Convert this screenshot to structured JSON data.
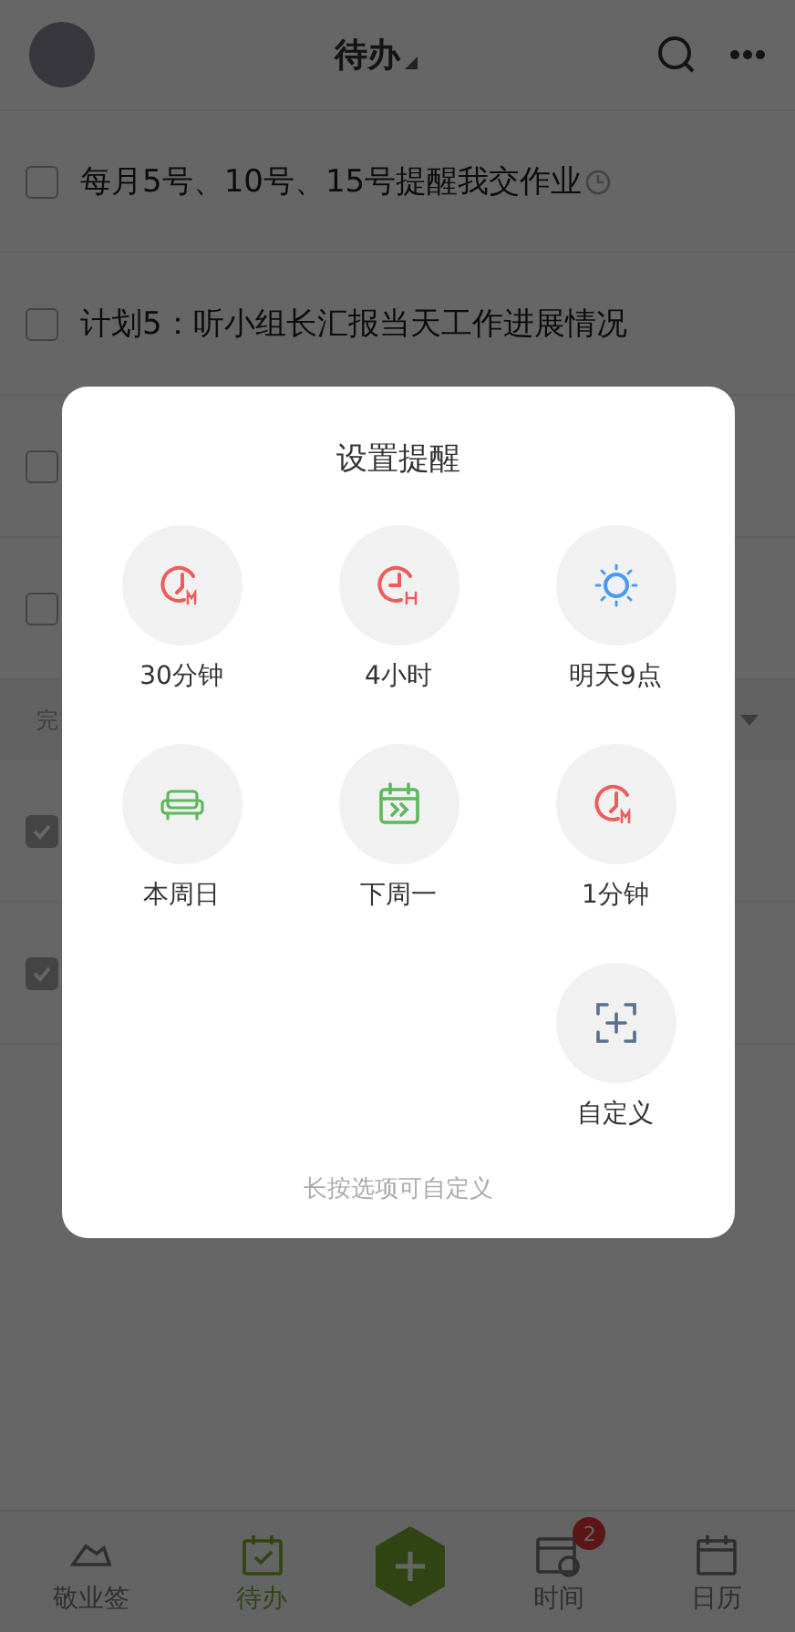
{
  "header": {
    "title": "待办"
  },
  "todos": [
    {
      "text": "每月5号、10号、15号提醒我交作业",
      "checked": false,
      "reminder": true
    },
    {
      "text": "计划5：听小组长汇报当天工作进展情况",
      "checked": false,
      "reminder": false
    },
    {
      "checked": false
    },
    {
      "checked": false
    }
  ],
  "done_section": {
    "label": "完"
  },
  "done_todos": [
    {
      "checked": true
    },
    {
      "checked": true
    }
  ],
  "dialog": {
    "title": "设置提醒",
    "options": [
      {
        "label": "30分钟",
        "kind": "minutes"
      },
      {
        "label": "4小时",
        "kind": "hours"
      },
      {
        "label": "明天9点",
        "kind": "sun"
      },
      {
        "label": "本周日",
        "kind": "sofa"
      },
      {
        "label": "下周一",
        "kind": "calendar"
      },
      {
        "label": "1分钟",
        "kind": "minutes"
      },
      {
        "label": "自定义",
        "kind": "custom"
      }
    ],
    "hint": "长按选项可自定义"
  },
  "tab_bar": [
    {
      "label": "敬业签",
      "kind": "notes",
      "selected": false
    },
    {
      "label": "待办",
      "kind": "todo",
      "selected": true
    },
    {
      "kind": "add",
      "selected": false
    },
    {
      "label": "时间",
      "kind": "timeline",
      "selected": false,
      "badge": "2"
    },
    {
      "label": "日历",
      "kind": "calendar",
      "selected": false
    }
  ]
}
